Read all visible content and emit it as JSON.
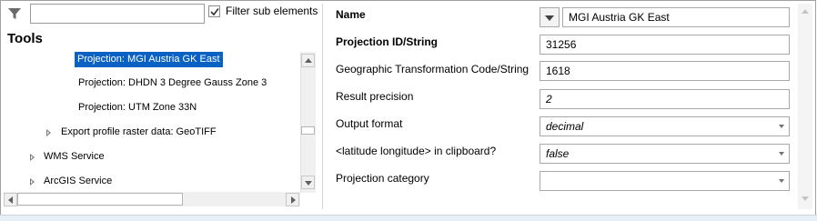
{
  "left_panel": {
    "filter_input_value": "",
    "filter_checkbox_label": "Filter sub elements",
    "filter_checkbox_checked": true,
    "title": "Tools",
    "tree_items": [
      {
        "label": "Projection: MGI Austria GK East",
        "selected": true
      },
      {
        "label": "Projection: DHDN 3 Degree Gauss Zone 3",
        "selected": false
      },
      {
        "label": "Projection: UTM Zone 33N",
        "selected": false
      },
      {
        "label": "Export profile raster data: GeoTIFF",
        "selected": false
      },
      {
        "label": "WMS Service",
        "selected": false
      },
      {
        "label": "ArcGIS Service",
        "selected": false
      }
    ]
  },
  "properties": {
    "name": {
      "label": "Name",
      "value": "MGI Austria GK East"
    },
    "projection_id": {
      "label": "Projection ID/String",
      "value": "31256"
    },
    "geo_transform": {
      "label": "Geographic Transformation Code/String",
      "value": "1618"
    },
    "result_precision": {
      "label": "Result precision",
      "value": "2"
    },
    "output_format": {
      "label": "Output format",
      "value": "decimal"
    },
    "clipboard": {
      "label": "<latitude longitude> in clipboard?",
      "value": "false"
    },
    "projection_category": {
      "label": "Projection category",
      "value": ""
    }
  },
  "colors": {
    "selection": "#0a61c4",
    "bottom_bar": "#e8eef5"
  }
}
